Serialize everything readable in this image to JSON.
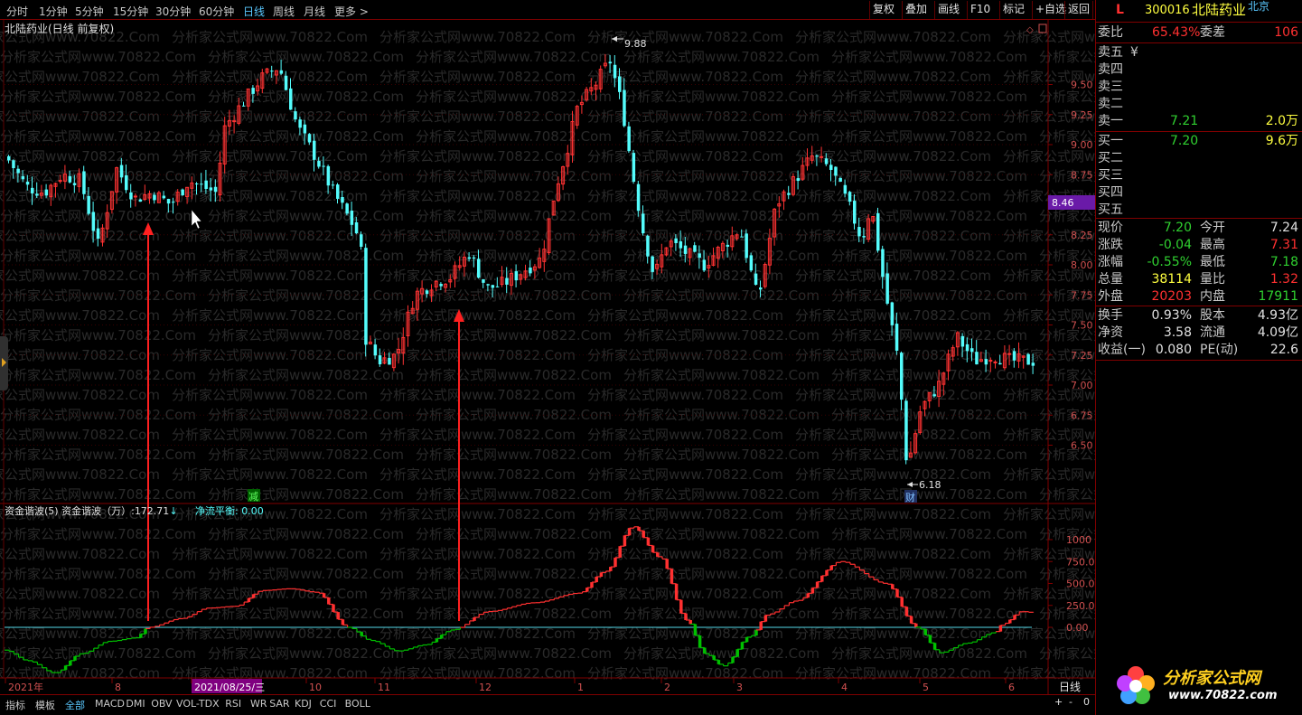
{
  "periods": [
    "分时",
    "1分钟",
    "5分钟",
    "15分钟",
    "30分钟",
    "60分钟",
    "日线",
    "周线",
    "月线",
    "更多 >"
  ],
  "active_period": "日线",
  "toolbar": {
    "btn1": "复权",
    "btn2": "叠加",
    "btn3": "画线",
    "btn4": "F10",
    "btn5": "标记",
    "btn6": "+自选",
    "btn7": "返回"
  },
  "chart_title": "北陆药业(日线 前复权)",
  "watermark": "分析家公式网www.70822.Com",
  "price_axis": [
    "9.50",
    "9.25",
    "9.00",
    "8.75",
    "8.25",
    "8.00",
    "7.75",
    "7.50",
    "7.25",
    "7.00",
    "6.75",
    "6.50"
  ],
  "current_price_tag": "8.46",
  "high_label": "9.88",
  "low_label": "6.18",
  "marker_reduce": "减",
  "marker_fin": "财",
  "indicator": {
    "name": "资金谐波(5)",
    "label": "资金谐波（万）:",
    "value": "172.71",
    "arrow": "↓",
    "balance_label": "净流平衡:",
    "balance_value": "0.00"
  },
  "indicator_axis": [
    "1000",
    "750.0",
    "500.0",
    "250.0",
    "0.00"
  ],
  "time_axis": {
    "labels": [
      "2021年",
      "8",
      "2021/08/25/三",
      "10",
      "11",
      "12",
      "1",
      "2",
      "3",
      "4",
      "5",
      "6"
    ],
    "period": "日线"
  },
  "zoom": {
    "plus": "+",
    "minus": "-",
    "zero": "0"
  },
  "bottom_tabs": [
    "指标",
    "模板",
    "全部",
    "MACD",
    "DMI",
    "OBV",
    "VOL-TDX",
    "RSI",
    "WR",
    "SAR",
    "KDJ",
    "CCI",
    "BOLL"
  ],
  "active_bottom_tab": "全部",
  "stock": {
    "flag": "L",
    "code": "300016",
    "name": "北陆药业",
    "market": "北京"
  },
  "quote": {
    "wb_label": "委比",
    "wb_value": "65.43%",
    "wc_label": "委差",
    "wc_value": "106",
    "sells": [
      {
        "label": "卖五",
        "mark": "¥",
        "price": "",
        "vol": ""
      },
      {
        "label": "卖四",
        "price": "",
        "vol": ""
      },
      {
        "label": "卖三",
        "price": "",
        "vol": ""
      },
      {
        "label": "卖二",
        "price": "",
        "vol": ""
      },
      {
        "label": "卖一",
        "price": "7.21",
        "vol": "2.0万"
      }
    ],
    "buys": [
      {
        "label": "买一",
        "price": "7.20",
        "vol": "9.6万"
      },
      {
        "label": "买二",
        "price": "",
        "vol": ""
      },
      {
        "label": "买三",
        "price": "",
        "vol": ""
      },
      {
        "label": "买四",
        "price": "",
        "vol": ""
      },
      {
        "label": "买五",
        "price": "",
        "vol": ""
      }
    ],
    "rows1": [
      {
        "l1": "现价",
        "v1": "7.20",
        "l2": "今开",
        "v2": "7.24"
      },
      {
        "l1": "涨跌",
        "v1": "-0.04",
        "l2": "最高",
        "v2": "7.31"
      },
      {
        "l1": "涨幅",
        "v1": "-0.55%",
        "l2": "最低",
        "v2": "7.18"
      },
      {
        "l1": "总量",
        "v1": "38114",
        "l2": "量比",
        "v2": "1.32"
      },
      {
        "l1": "外盘",
        "v1": "20203",
        "l2": "内盘",
        "v2": "17911"
      }
    ],
    "rows2": [
      {
        "l1": "换手",
        "v1": "0.93%",
        "l2": "股本",
        "v2": "4.93亿"
      },
      {
        "l1": "净资",
        "v1": "3.58",
        "l2": "流通",
        "v2": "4.09亿"
      },
      {
        "l1": "收益(一)",
        "v1": "0.080",
        "l2": "PE(动)",
        "v2": "22.6"
      }
    ]
  },
  "logo": {
    "text": "分析家公式网",
    "url": "www.70822.com"
  },
  "colors": {
    "up": "#ff3232",
    "down": "#54fcfc",
    "axis": "#800000",
    "green": "#00c000",
    "red": "#ff3030",
    "purple": "#800080"
  }
}
